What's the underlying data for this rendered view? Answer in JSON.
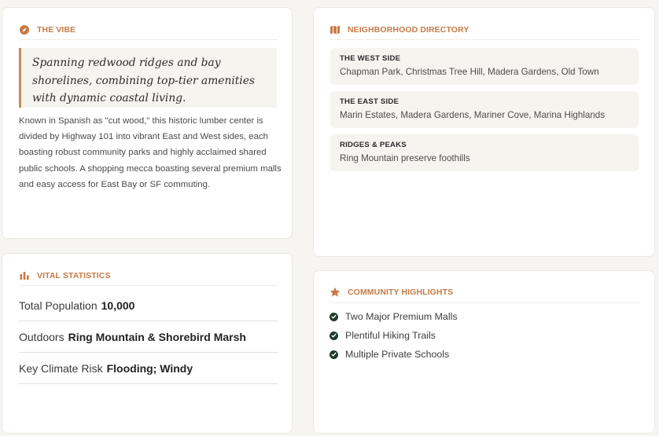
{
  "vibe": {
    "title": "THE VIBE",
    "quote": "Spanning redwood ridges and bay shorelines, combining top-tier amenities with dynamic coastal living.",
    "body": "Known in Spanish as \"cut wood,\" this historic lumber center is divided by Highway 101 into vibrant East and West sides, each boasting robust community parks and highly acclaimed shared public schools. A shopping mecca boasting several premium malls and easy access for East Bay or SF commuting."
  },
  "directory": {
    "title": "NEIGHBORHOOD DIRECTORY",
    "items": [
      {
        "label": "THE WEST SIDE",
        "value": "Chapman Park, Christmas Tree Hill, Madera Gardens, Old Town"
      },
      {
        "label": "THE EAST SIDE",
        "value": "Marin Estates, Madera Gardens, Mariner Cove, Marina Highlands"
      },
      {
        "label": "RIDGES & PEAKS",
        "value": "Ring Mountain preserve foothills"
      }
    ]
  },
  "stats": {
    "title": "VITAL STATISTICS",
    "rows": [
      {
        "label": "Total Population",
        "value": "10,000"
      },
      {
        "label": "Outdoors",
        "value": "Ring Mountain & Shorebird Marsh"
      },
      {
        "label": "Key Climate Risk",
        "value": "Flooding; Windy"
      }
    ]
  },
  "highlights": {
    "title": "COMMUNITY HIGHLIGHTS",
    "items": [
      "Two Major Premium Malls",
      "Plentiful Hiking Trails",
      "Multiple Private Schools"
    ]
  },
  "icons": {
    "vibe": "compass-icon",
    "directory": "map-icon",
    "stats": "bar-chart-icon",
    "highlights": "star-icon",
    "check": "check-circle-icon"
  },
  "colors": {
    "accent": "#c77a45",
    "check": "#1f3a2a",
    "background": "#f6f5f1"
  }
}
